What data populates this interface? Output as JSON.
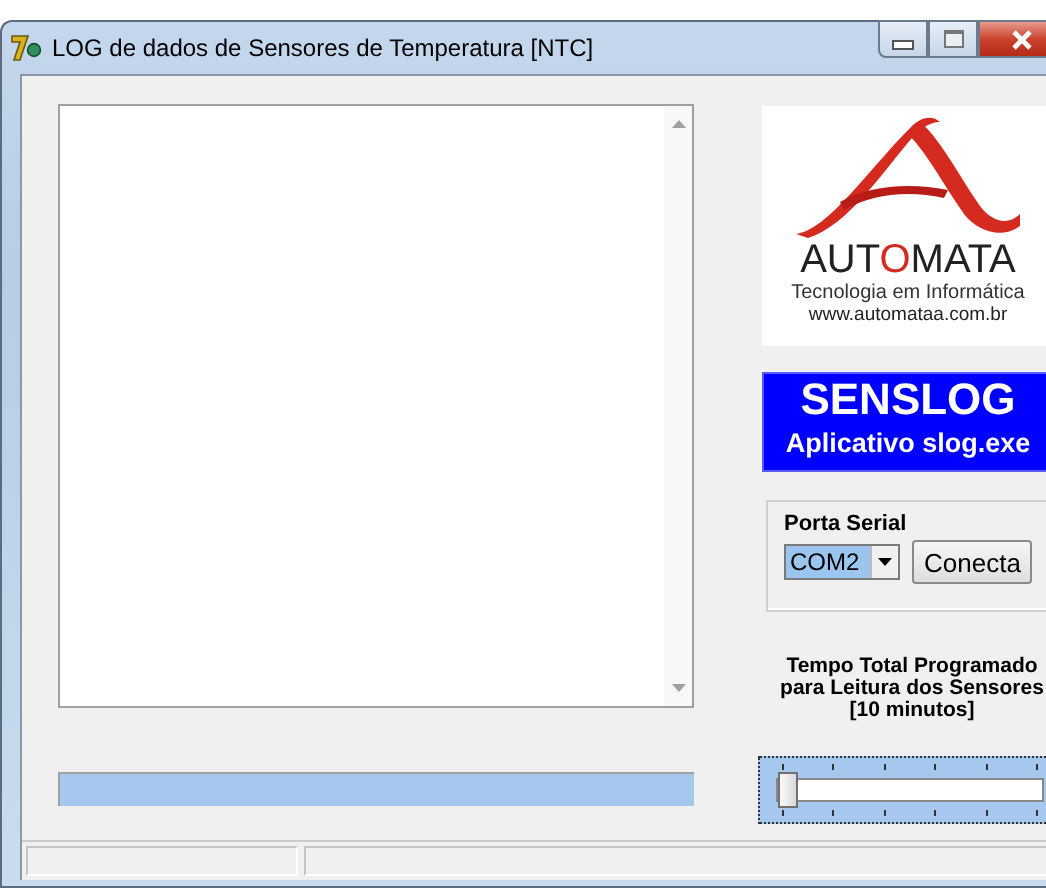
{
  "window": {
    "title": "LOG de dados de Sensores de Temperatura [NTC]"
  },
  "logo": {
    "brand_parts": [
      "AUT",
      "O",
      "MATA"
    ],
    "tagline": "Tecnologia em Informática",
    "url": "www.automataa.com.br"
  },
  "banner": {
    "title": "SENSLOG",
    "subtitle": "Aplicativo slog.exe"
  },
  "serial": {
    "label": "Porta Serial",
    "port": "COM2",
    "button": "Conecta"
  },
  "timer": {
    "caption_lines": [
      "Tempo Total Programado",
      "para Leitura dos Sensores",
      "[10 minutos]"
    ],
    "slider": {
      "level": 0,
      "focused": true
    }
  }
}
